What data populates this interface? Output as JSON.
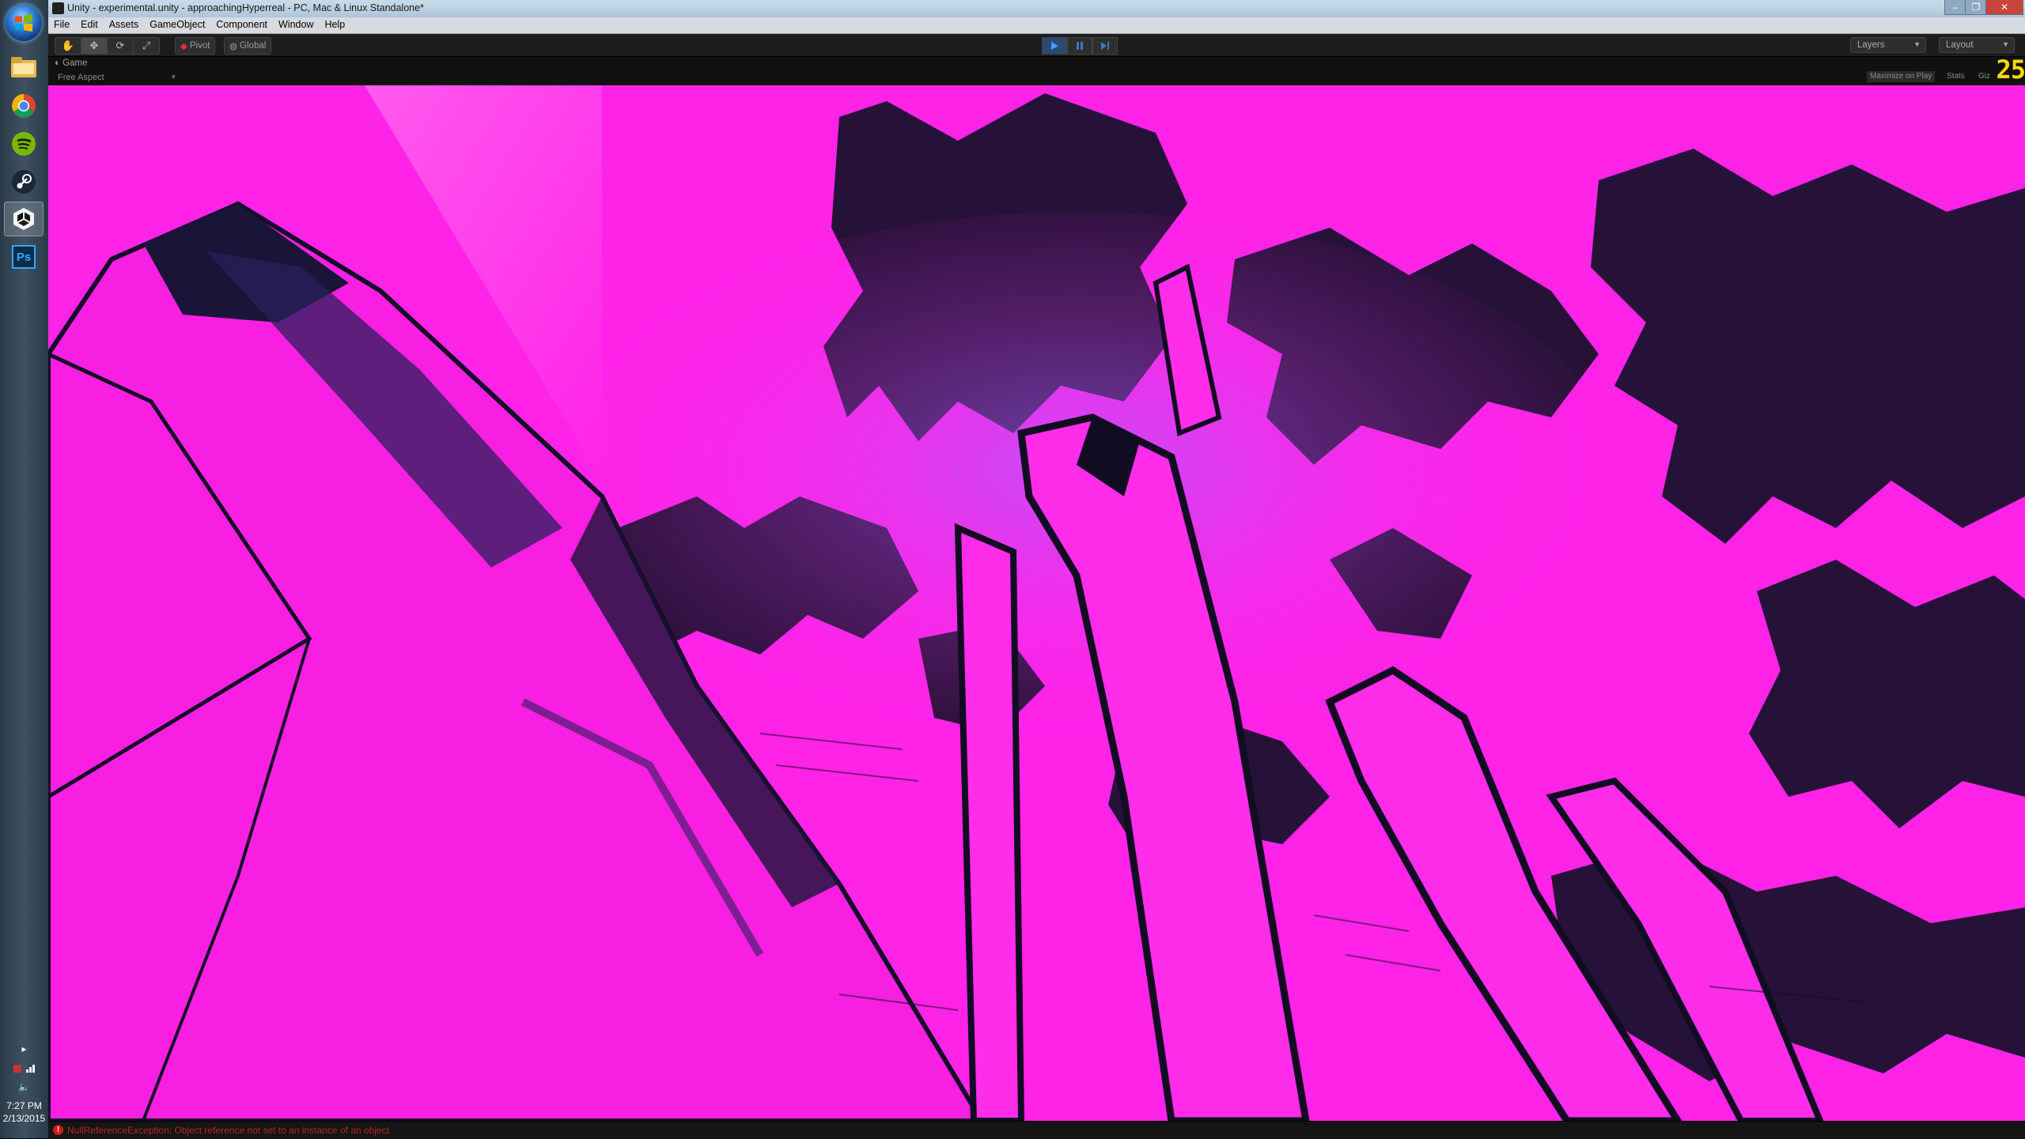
{
  "window": {
    "title": "Unity - experimental.unity - approachingHyperreal - PC, Mac & Linux Standalone*"
  },
  "menu": [
    "File",
    "Edit",
    "Assets",
    "GameObject",
    "Component",
    "Window",
    "Help"
  ],
  "toolbar": {
    "pivot_label": "Pivot",
    "global_label": "Global",
    "layers_label": "Layers",
    "layout_label": "Layout",
    "accent": "#2a4a74"
  },
  "game_view": {
    "tab_label": "Game",
    "aspect_label": "Free Aspect",
    "maximize_label": "Maximize on Play",
    "stats_label": "Stats",
    "gizmos_label": "Giz",
    "fps": "25",
    "scene_color": "#ff23e8"
  },
  "taskbar": {
    "apps": [
      "file-explorer-icon",
      "chrome-icon",
      "spotify-icon",
      "steam-icon",
      "unity-icon",
      "photoshop-icon"
    ],
    "photoshop_label": "Ps",
    "time": "7:27 PM",
    "date": "2/13/2015"
  },
  "status": {
    "error_message": "NullReferenceException: Object reference not set to an instance of an object"
  }
}
